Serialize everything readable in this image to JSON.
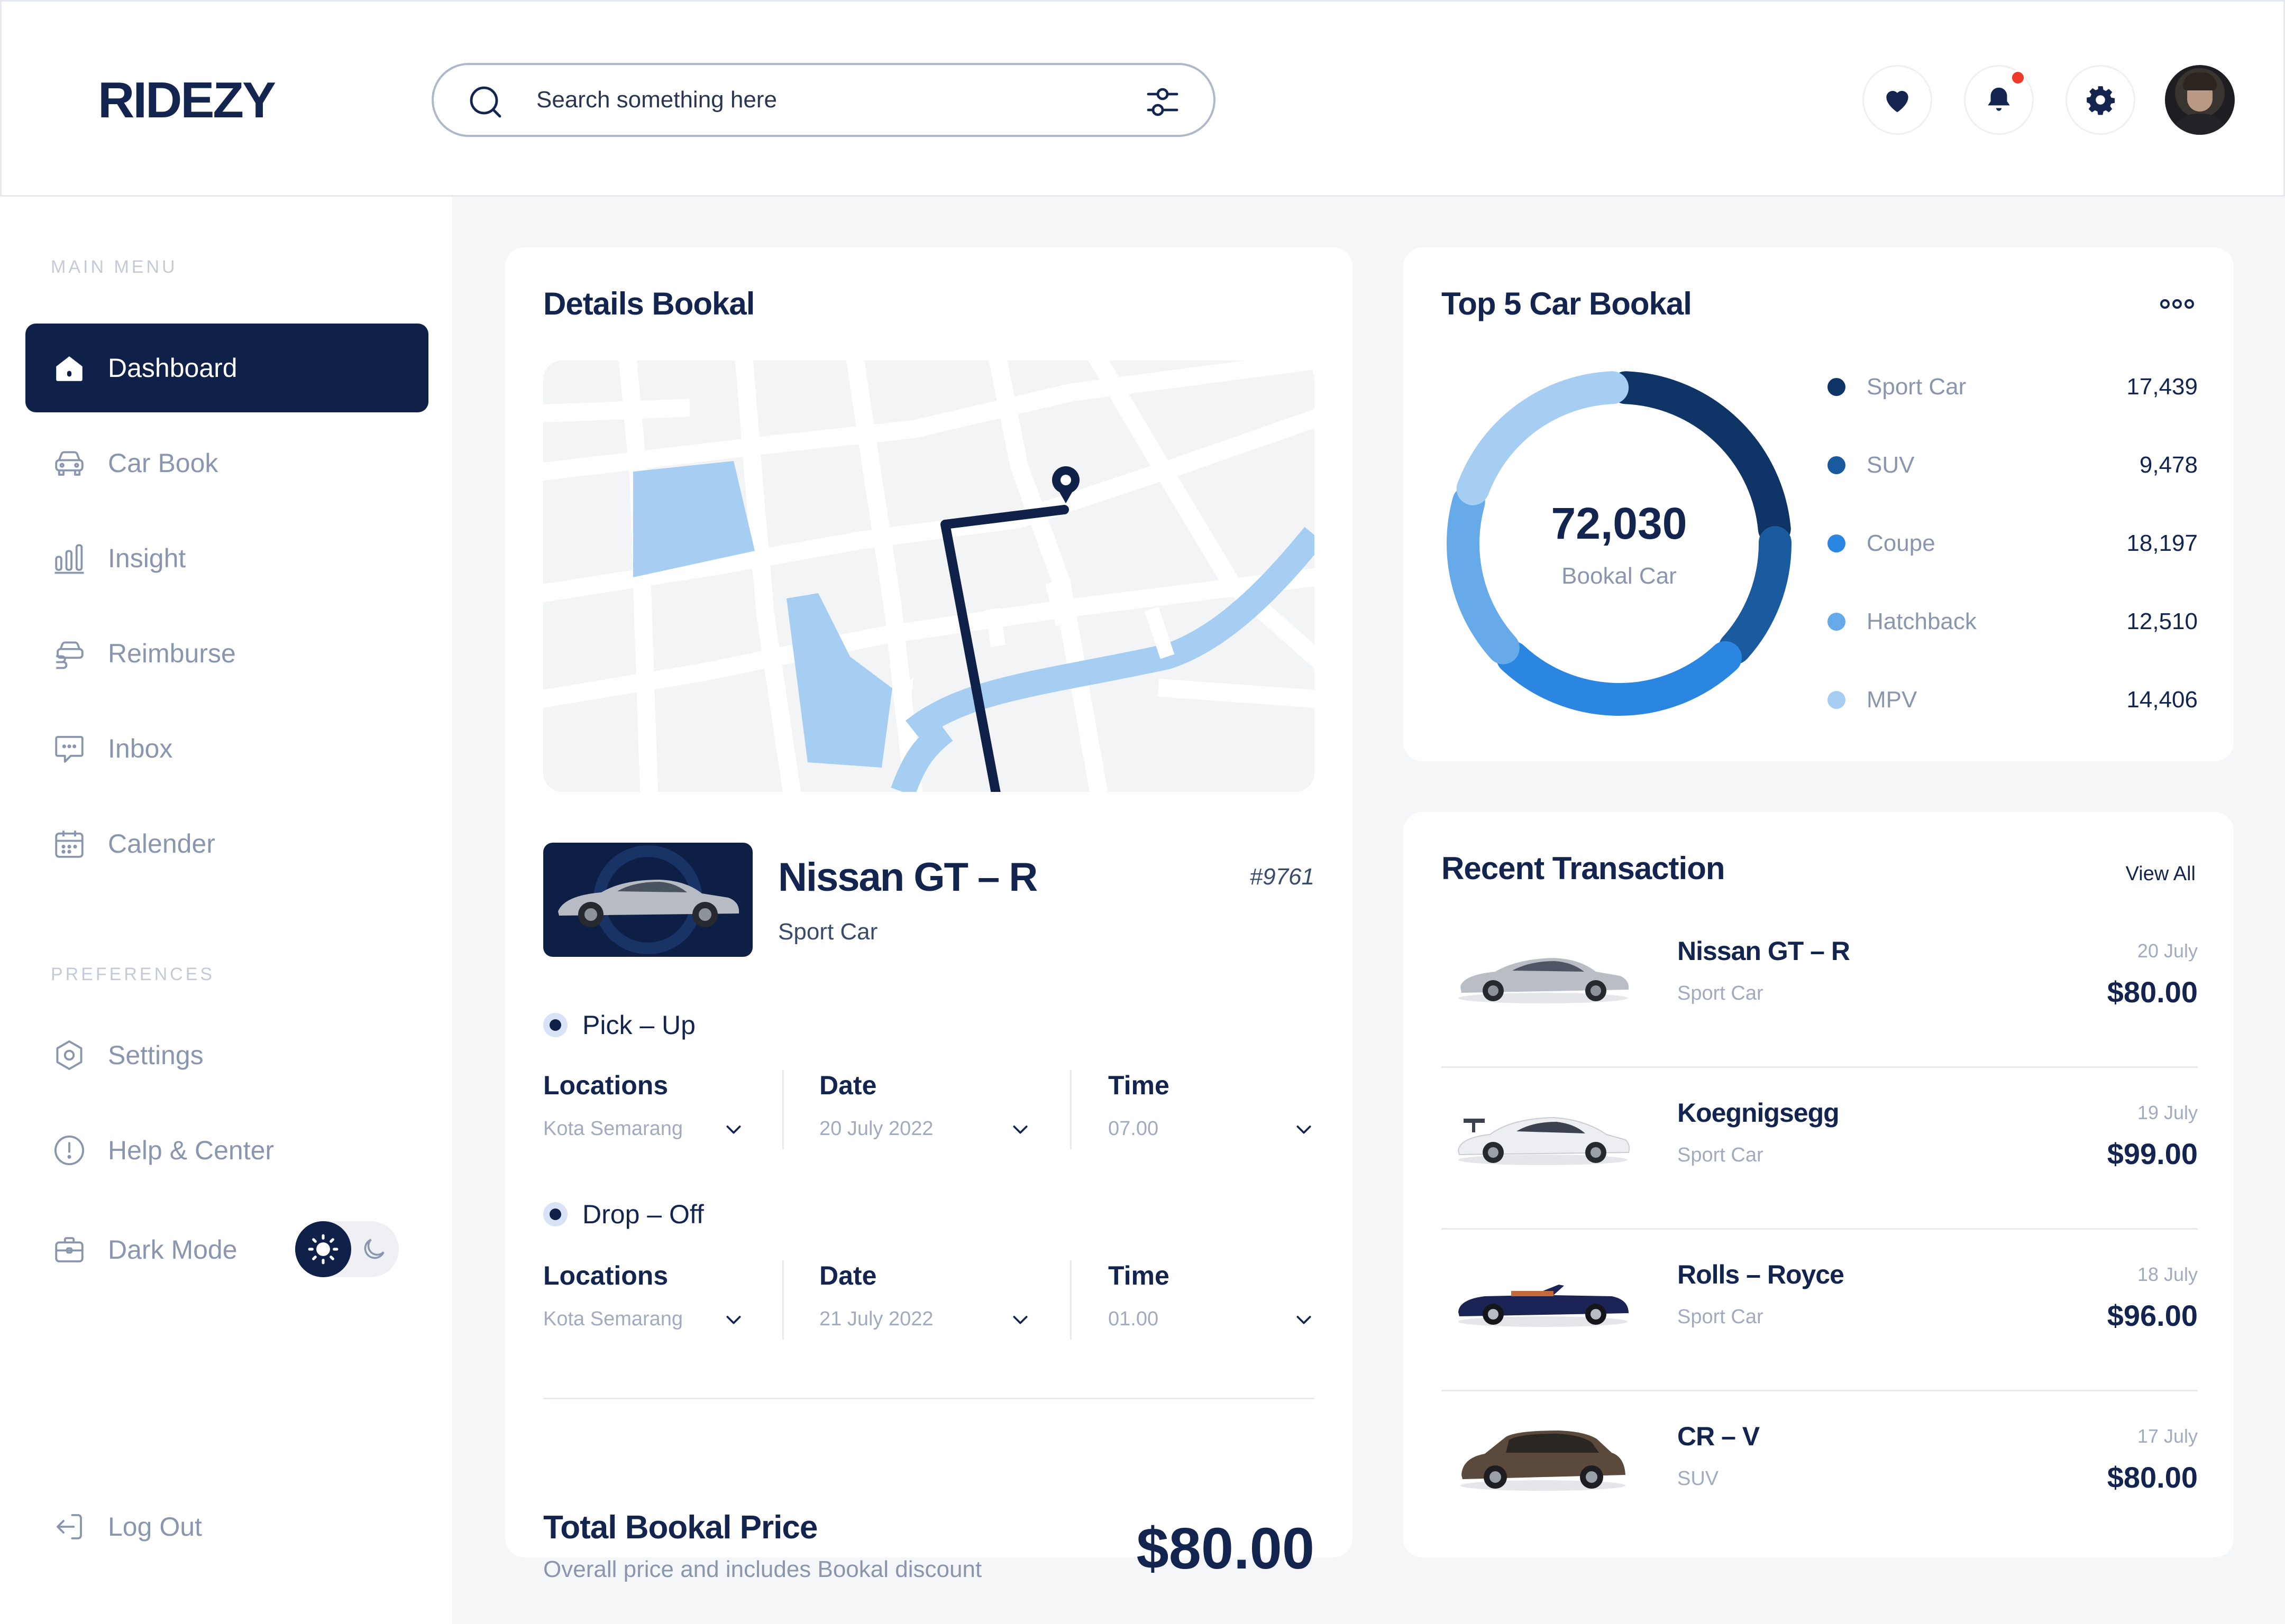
{
  "app": {
    "logo": "RIDEZY"
  },
  "search": {
    "placeholder": "Search something here"
  },
  "sidebar": {
    "main_menu_label": "MAIN MENU",
    "preferences_label": "PREFERENCES",
    "items": [
      {
        "label": "Dashboard",
        "icon": "home-icon"
      },
      {
        "label": "Car Book",
        "icon": "car-icon"
      },
      {
        "label": "Insight",
        "icon": "bar-chart-icon"
      },
      {
        "label": "Reimburse",
        "icon": "reimburse-icon"
      },
      {
        "label": "Inbox",
        "icon": "chat-icon"
      },
      {
        "label": "Calender",
        "icon": "calendar-icon"
      }
    ],
    "prefs": [
      {
        "label": "Settings",
        "icon": "settings-icon"
      },
      {
        "label": "Help & Center",
        "icon": "help-icon"
      },
      {
        "label": "Dark Mode",
        "icon": "briefcase-icon"
      }
    ],
    "logout": "Log Out"
  },
  "details": {
    "title": "Details Bookal",
    "car_name": "Nissan GT – R",
    "car_type": "Sport Car",
    "car_code": "#9761",
    "pickup": {
      "label": "Pick – Up",
      "location_label": "Locations",
      "location": "Kota Semarang",
      "date_label": "Date",
      "date": "20 July 2022",
      "time_label": "Time",
      "time": "07.00"
    },
    "dropoff": {
      "label": "Drop – Off",
      "location_label": "Locations",
      "location": "Kota Semarang",
      "date_label": "Date",
      "date": "21 July 2022",
      "time_label": "Time",
      "time": "01.00"
    },
    "total_label": "Total Bookal Price",
    "total_sub": "Overall price and includes Bookal discount",
    "total_value": "$80.00"
  },
  "top5": {
    "title": "Top 5 Car Bookal",
    "center_value": "72,030",
    "center_label": "Bookal Car",
    "colors": [
      "#0f3566",
      "#1a5a9e",
      "#2a86e0",
      "#66aaea",
      "#a6cdf2"
    ]
  },
  "chart_data": {
    "type": "pie",
    "title": "Top 5 Car Bookal",
    "categories": [
      "Sport Car",
      "SUV",
      "Coupe",
      "Hatchback",
      "MPV"
    ],
    "values": [
      17439,
      9478,
      18197,
      12510,
      14406
    ],
    "display_values": [
      "17,439",
      "9,478",
      "18,197",
      "12,510",
      "14,406"
    ]
  },
  "transactions": {
    "title": "Recent Transaction",
    "view_all": "View All",
    "rows": [
      {
        "name": "Nissan GT – R",
        "type": "Sport Car",
        "date": "20 July",
        "price": "$80.00"
      },
      {
        "name": "Koegnigsegg",
        "type": "Sport Car",
        "date": "19 July",
        "price": "$99.00"
      },
      {
        "name": "Rolls – Royce",
        "type": "Sport Car",
        "date": "18 July",
        "price": "$96.00"
      },
      {
        "name": "CR – V",
        "type": "SUV",
        "date": "17 July",
        "price": "$80.00"
      }
    ]
  }
}
